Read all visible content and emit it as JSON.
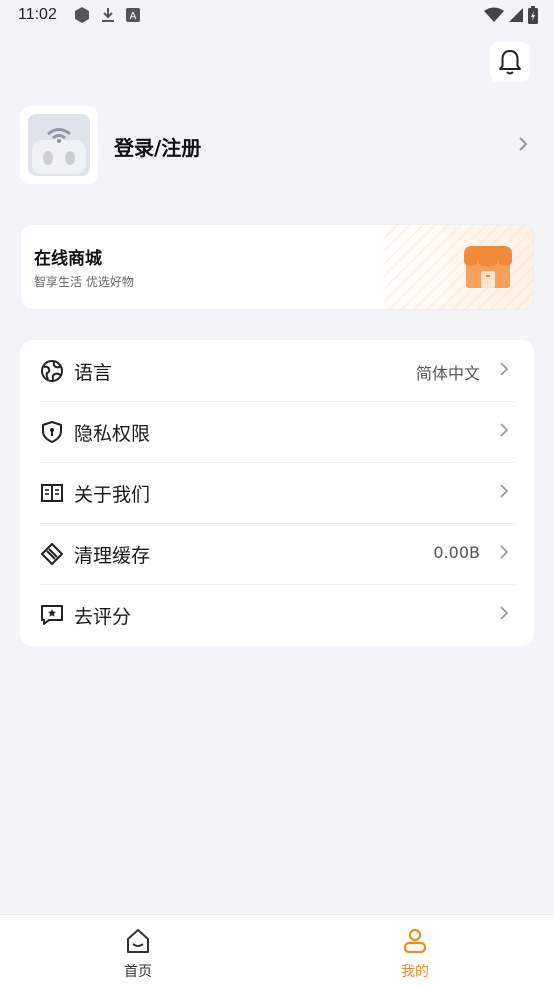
{
  "status_bar": {
    "time": "11:02",
    "left_icons": [
      "settings-hex-icon",
      "download-icon",
      "a-box-icon"
    ],
    "right_icons": [
      "wifi-icon",
      "signal-icon",
      "battery-charging-icon"
    ]
  },
  "header": {
    "bell_icon": "bell-icon"
  },
  "profile": {
    "login_label": "登录/注册",
    "avatar_icon": "robot-avatar-icon"
  },
  "mall": {
    "title": "在线商城",
    "subtitle": "智享生活 优选好物",
    "icon": "shop-icon"
  },
  "menu": {
    "items": [
      {
        "label": "语言",
        "value": "简体中文",
        "icon": "globe-icon"
      },
      {
        "label": "隐私权限",
        "value": "",
        "icon": "shield-icon"
      },
      {
        "label": "关于我们",
        "value": "",
        "icon": "book-icon"
      },
      {
        "label": "清理缓存",
        "value": "0.00B",
        "icon": "broom-icon"
      },
      {
        "label": "去评分",
        "value": "",
        "icon": "rating-icon"
      }
    ]
  },
  "tabbar": {
    "tabs": [
      {
        "label": "首页",
        "icon": "home-icon",
        "active": false
      },
      {
        "label": "我的",
        "icon": "user-icon",
        "active": true
      }
    ]
  },
  "colors": {
    "accent": "#f08a24",
    "background": "#f2f4f7",
    "text": "#1a1a1a",
    "inactive_tab": "#333333"
  }
}
